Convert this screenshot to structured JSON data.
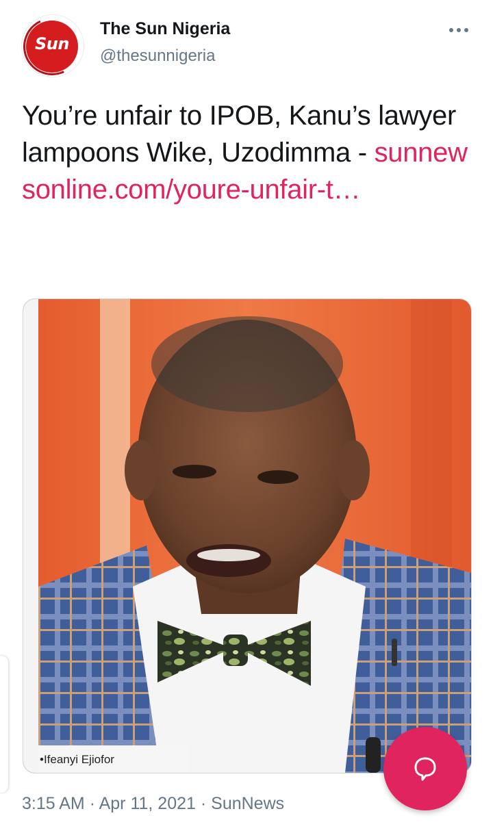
{
  "tweet": {
    "author": {
      "display_name": "The Sun Nigeria",
      "handle": "@thesunnigeria",
      "avatar_logo_text": "Sun",
      "brand_color": "#d51d1f"
    },
    "text": "You’re unfair to IPOB, Kanu’s lawyer lampoons Wike, Uzodimma - ",
    "link_text": "sunnewsonline.com/youre-unfair-t…",
    "link_color": "#e0245e",
    "media": {
      "caption": "•Ifeanyi Ejiofor"
    },
    "meta": {
      "time": "3:15 AM",
      "separator": "·",
      "date": "Apr 11, 2021",
      "source": "SunNews"
    }
  },
  "icons": {
    "more": "more-dots-icon",
    "compose": "reply-bubble-icon"
  },
  "fab": {
    "color": "#e0245e"
  }
}
